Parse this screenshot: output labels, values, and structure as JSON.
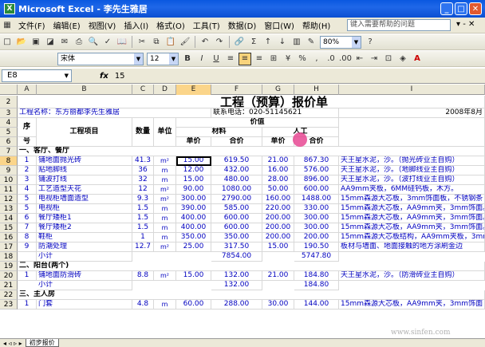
{
  "window": {
    "title": "Microsoft Excel - 李先生雅居",
    "app_icon": "X"
  },
  "menu": [
    "文件(F)",
    "编辑(E)",
    "视图(V)",
    "插入(I)",
    "格式(O)",
    "工具(T)",
    "数据(D)",
    "窗口(W)",
    "帮助(H)"
  ],
  "help_placeholder": "键入需要帮助的问题",
  "toolbar": {
    "zoom": "80%",
    "font": "宋体",
    "font_size": "12"
  },
  "formula_bar": {
    "cell_ref": "E8",
    "fx": "fx",
    "value": "15"
  },
  "columns": [
    "A",
    "B",
    "C",
    "D",
    "E",
    "F",
    "G",
    "H",
    "I"
  ],
  "sheet": {
    "title": "工程（预算）报价单",
    "project_label": "工程名称：东方丽都李先生雅居",
    "phone_label": "联系电话：020-51145621",
    "date_label": "2008年8月",
    "header_seq": "序",
    "header_no": "号",
    "header_item": "工程项目",
    "header_qty": "数量",
    "header_unit": "单位",
    "header_price": "价值",
    "header_material": "材料",
    "header_labor": "人工",
    "header_unitprice": "单价",
    "header_total": "合价",
    "header_unitprice2": "单价",
    "header_total2": "合价",
    "section1": "一、客厅、餐厅",
    "section2": "二、阳台(两个)",
    "section3": "三、主人房",
    "rows": [
      {
        "r": "8",
        "n": "1",
        "item": "铺地面抛光砖",
        "qty": "41.3",
        "unit": "m²",
        "up": "15.00",
        "tot": "619.50",
        "lup": "21.00",
        "ltot": "867.30",
        "note": "天王星水泥，沙。（抛光砖业主自购）"
      },
      {
        "r": "9",
        "n": "2",
        "item": "贴地脚线",
        "qty": "36",
        "unit": "m",
        "up": "12.00",
        "tot": "432.00",
        "lup": "16.00",
        "ltot": "576.00",
        "note": "天王星水泥，沙。（地脚线业主自购）"
      },
      {
        "r": "10",
        "n": "3",
        "item": "铺波打线",
        "qty": "32",
        "unit": "m",
        "up": "15.00",
        "tot": "480.00",
        "lup": "28.00",
        "ltot": "896.00",
        "note": "天王星水泥，沙。（波打线业主自购）"
      },
      {
        "r": "11",
        "n": "4",
        "item": "工艺造型天花",
        "qty": "12",
        "unit": "m²",
        "up": "90.00",
        "tot": "1080.00",
        "lup": "50.00",
        "ltot": "600.00",
        "note": "AA9mm夹板，6MM硅钙板，木方。"
      },
      {
        "r": "12",
        "n": "5",
        "item": "电视柜墙面造型",
        "qty": "9.3",
        "unit": "m²",
        "up": "300.00",
        "tot": "2790.00",
        "lup": "160.00",
        "ltot": "1488.00",
        "note": "15mm森源大芯板，3mm饰面板，不锈钢条"
      },
      {
        "r": "13",
        "n": "5",
        "item": "电视柜",
        "qty": "1.5",
        "unit": "m",
        "up": "390.00",
        "tot": "585.00",
        "lup": "220.00",
        "ltot": "330.00",
        "note": "15mm森源大芯板，AA9mm夹，3mm饰面。"
      },
      {
        "r": "14",
        "n": "6",
        "item": "餐厅矮柜1",
        "qty": "1.5",
        "unit": "m",
        "up": "400.00",
        "tot": "600.00",
        "lup": "200.00",
        "ltot": "300.00",
        "note": "15mm森源大芯板，AA9mm夹，3mm饰面。"
      },
      {
        "r": "15",
        "n": "7",
        "item": "餐厅矮柜2",
        "qty": "1.5",
        "unit": "m",
        "up": "400.00",
        "tot": "600.00",
        "lup": "200.00",
        "ltot": "300.00",
        "note": "15mm森源大芯板，AA9mm夹，3mm饰面。"
      },
      {
        "r": "16",
        "n": "8",
        "item": "鞋柜",
        "qty": "1",
        "unit": "m",
        "up": "350.00",
        "tot": "350.00",
        "lup": "200.00",
        "ltot": "200.00",
        "note": "15mm森源大芯板结构，AA9mm夹板，3mm"
      },
      {
        "r": "17",
        "n": "9",
        "item": "防潮处理",
        "qty": "12.7",
        "unit": "m²",
        "up": "25.00",
        "tot": "317.50",
        "lup": "15.00",
        "ltot": "190.50",
        "note": "板材与墙面、地面接触的地方涂刷金边"
      }
    ],
    "subtotal1": {
      "label": "小计",
      "tot": "7854.00",
      "ltot": "5747.80"
    },
    "row20": {
      "n": "1",
      "item": "铺地面防滑砖",
      "qty": "8.8",
      "unit": "m²",
      "up": "15.00",
      "tot": "132.00",
      "lup": "21.00",
      "ltot": "184.80",
      "note": "天王星水泥，沙。（防滑砖业主自购）"
    },
    "subtotal2": {
      "label": "小计",
      "tot": "132.00",
      "ltot": "184.80"
    },
    "row23": {
      "n": "1",
      "item": "门套",
      "qty": "4.8",
      "unit": "m",
      "up": "60.00",
      "tot": "288.00",
      "lup": "30.00",
      "ltot": "144.00",
      "note": "15mm森源大芯板，AA9mm夹，3mm饰面"
    }
  },
  "sheet_tab": "初步报价",
  "watermark": "www.sinfen.com"
}
